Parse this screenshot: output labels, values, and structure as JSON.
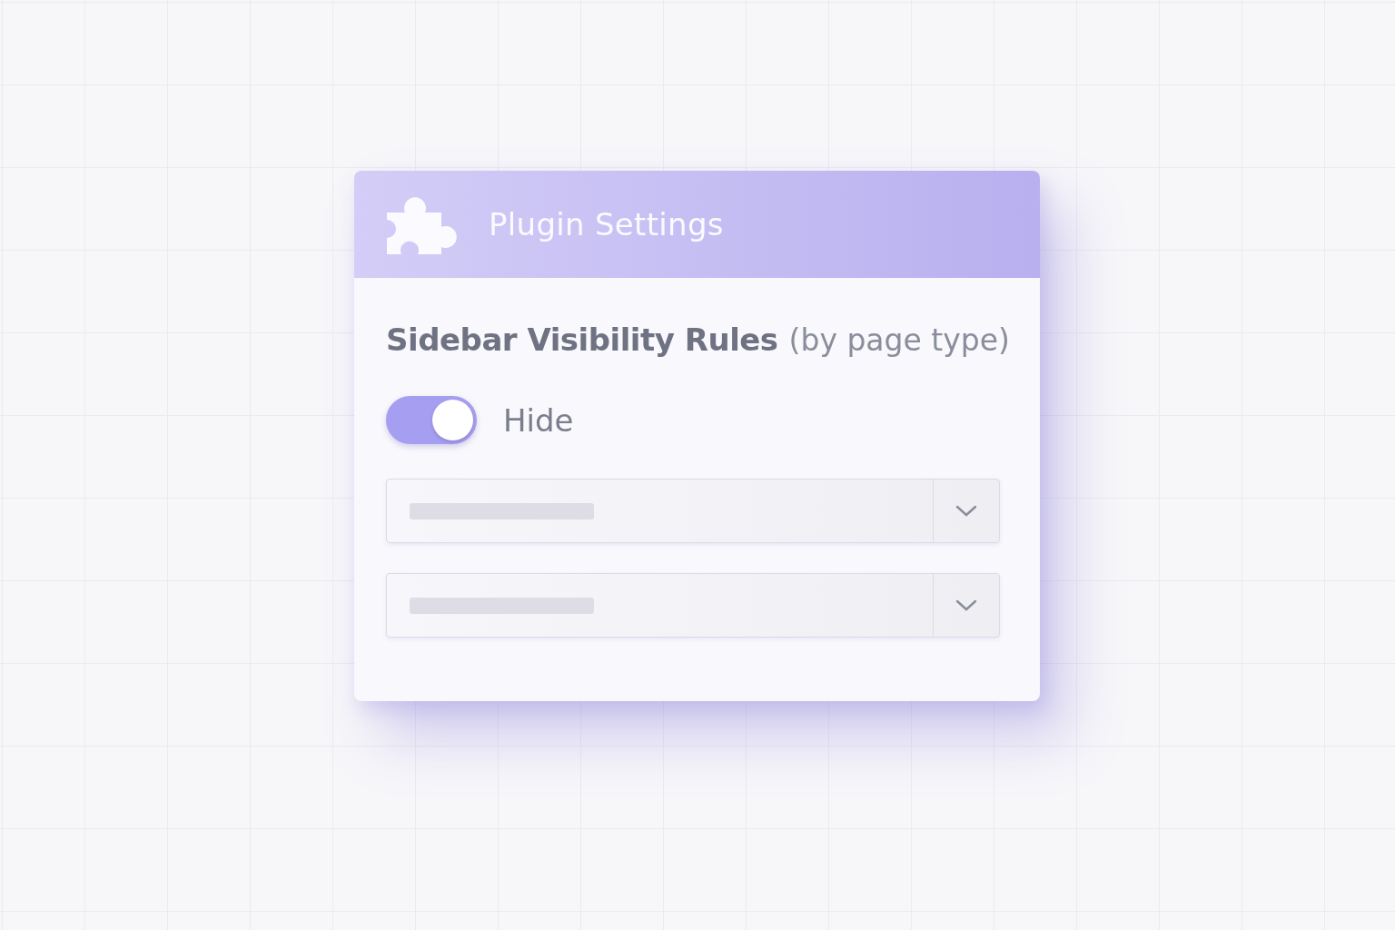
{
  "header": {
    "title": "Plugin Settings"
  },
  "section": {
    "title": "Sidebar Visibility Rules",
    "note": "(by page type)"
  },
  "toggle": {
    "label": "Hide",
    "on": true
  },
  "selects": [
    {
      "kind": "skeleton"
    },
    {
      "kind": "skeleton"
    }
  ]
}
